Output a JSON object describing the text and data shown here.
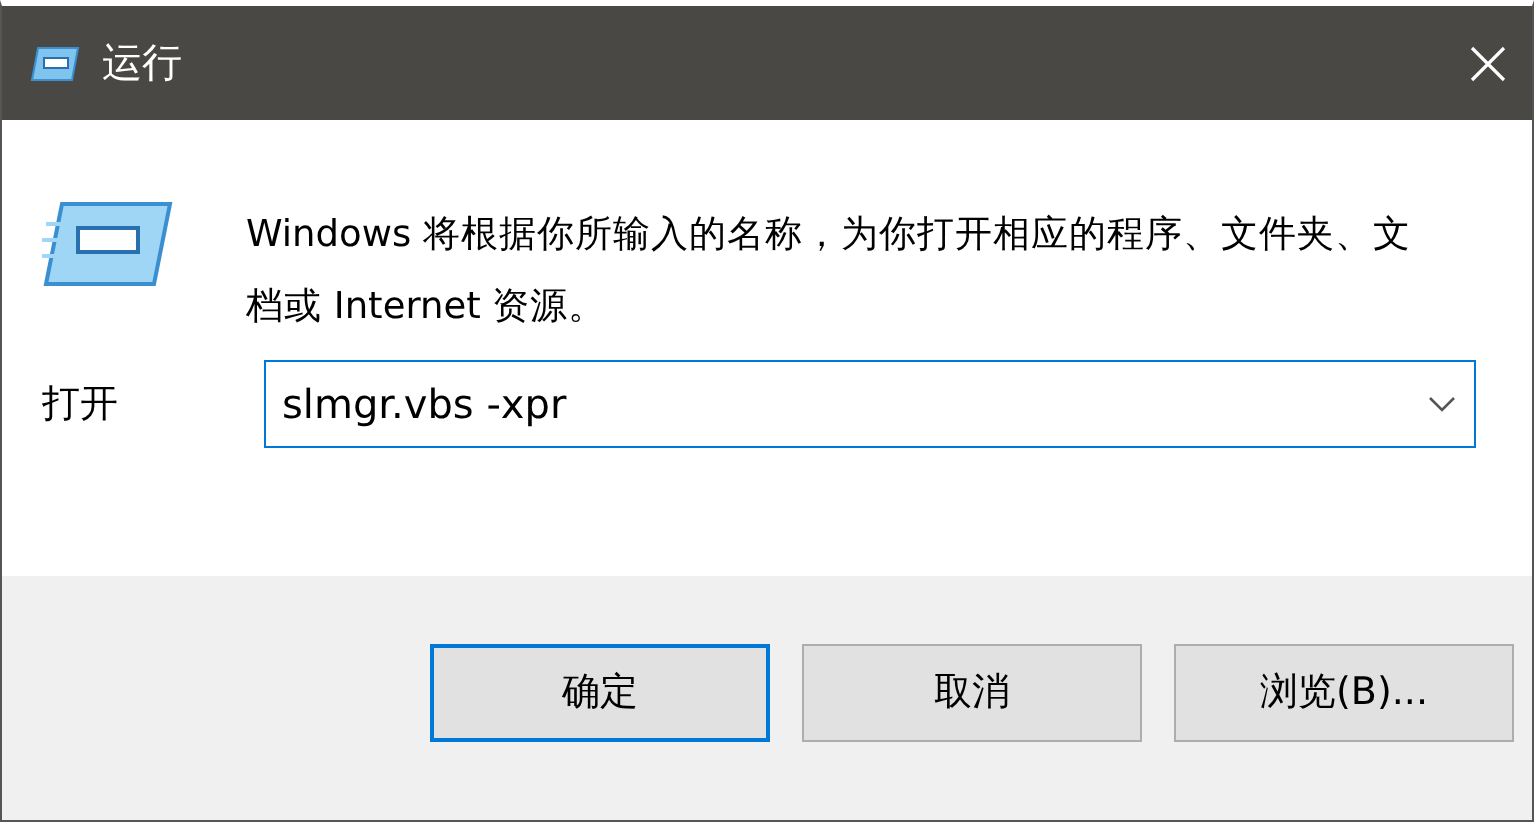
{
  "window": {
    "title": "运行"
  },
  "description": "Windows 将根据你所输入的名称，为你打开相应的程序、文件夹、文档或 Internet 资源。",
  "open_field": {
    "label": "打开",
    "value": "slmgr.vbs -xpr",
    "focused": true
  },
  "buttons": [
    {
      "label": "确定",
      "default": true
    },
    {
      "label": "取消",
      "default": false
    },
    {
      "label": "浏览(B)...",
      "default": false
    }
  ]
}
